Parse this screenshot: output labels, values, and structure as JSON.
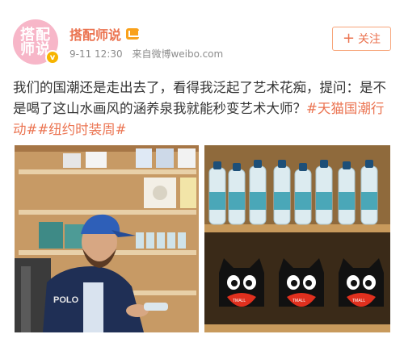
{
  "user": {
    "avatar_line1": "搭配",
    "avatar_line2": "师说",
    "name": "搭配师说",
    "time": "9-11 12:30",
    "source": "来自微博weibo.com"
  },
  "follow": {
    "label": "关注",
    "icon": "plus-icon"
  },
  "post": {
    "text": "我们的国潮还是走出去了，看得我泛起了艺术花痴，提问：是不是喝了这山水画风的涵养泉我就能秒变艺术大师？",
    "tags": [
      "#天猫国潮行动#",
      "#纽约时装周#"
    ]
  },
  "images": {
    "left_shirt_text": "POLO",
    "tmall_label": "TMALL"
  },
  "colors": {
    "accent": "#eb7350",
    "avatar_bg": "#f7b6c8",
    "verified": "#f7b400"
  }
}
